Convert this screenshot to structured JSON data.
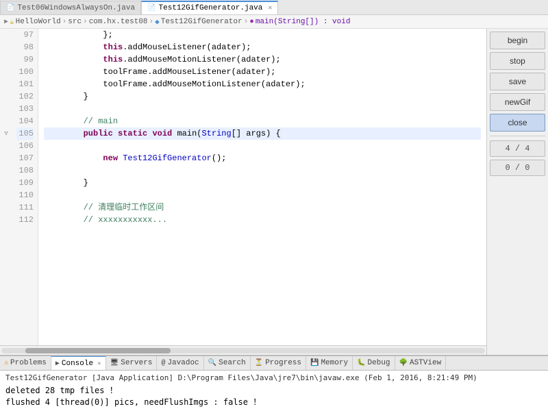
{
  "tabs": [
    {
      "label": "Test06WindowsAlwaysOn.java",
      "icon": "📄",
      "active": false
    },
    {
      "label": "Test12GifGenerator.java",
      "icon": "📄",
      "active": true,
      "closeable": true
    }
  ],
  "breadcrumb": {
    "items": [
      "HelloWorld",
      "src",
      "com.hx.test08",
      "Test12GifGenerator",
      "main(String[]) : void"
    ]
  },
  "code_lines": [
    {
      "num": 97,
      "text": "            };"
    },
    {
      "num": 98,
      "text": "            this.addMouseListener(adater);"
    },
    {
      "num": 99,
      "text": "            this.addMouseMotionListener(adater);"
    },
    {
      "num": 100,
      "text": "            toolFrame.addMouseListener(adater);"
    },
    {
      "num": 101,
      "text": "            toolFrame.addMouseMotionListener(adater);"
    },
    {
      "num": 102,
      "text": "        }"
    },
    {
      "num": 103,
      "text": ""
    },
    {
      "num": 104,
      "text": "        // main"
    },
    {
      "num": 105,
      "text": "        public static void main(String[] args) {",
      "collapse": true,
      "current": true
    },
    {
      "num": 106,
      "text": ""
    },
    {
      "num": 107,
      "text": "            new Test12GifGenerator();"
    },
    {
      "num": 108,
      "text": ""
    },
    {
      "num": 109,
      "text": "        }"
    },
    {
      "num": 110,
      "text": ""
    },
    {
      "num": 111,
      "text": "        // 清理临时工作区间"
    },
    {
      "num": 112,
      "text": "        // xxxxxxxxxxx..."
    }
  ],
  "right_panel": {
    "buttons": [
      {
        "label": "begin",
        "active": false
      },
      {
        "label": "stop",
        "active": false
      },
      {
        "label": "save",
        "active": false
      },
      {
        "label": "newGif",
        "active": false
      },
      {
        "label": "close",
        "active": true
      }
    ],
    "counts": [
      {
        "label": "4 / 4"
      },
      {
        "label": "0 / 0"
      }
    ]
  },
  "bottom_tabs": [
    {
      "label": "Problems",
      "icon": "⚠",
      "active": false
    },
    {
      "label": "Console",
      "icon": "▶",
      "active": true
    },
    {
      "label": "Servers",
      "icon": "🖥",
      "active": false
    },
    {
      "label": "Javadoc",
      "icon": "📖",
      "active": false
    },
    {
      "label": "Search",
      "icon": "🔍",
      "active": false
    },
    {
      "label": "Progress",
      "icon": "⏳",
      "active": false
    },
    {
      "label": "Memory",
      "icon": "💾",
      "active": false
    },
    {
      "label": "Debug",
      "icon": "🐛",
      "active": false
    },
    {
      "label": "ASTView",
      "icon": "🌳",
      "active": false
    }
  ],
  "console": {
    "header": "Test12GifGenerator [Java Application] D:\\Program Files\\Java\\jre7\\bin\\javaw.exe (Feb 1, 2016, 8:21:49 PM)",
    "lines": [
      "deleted 28 tmp files ！",
      "flushed 4 [thread(0)] pics, needFlushImgs : false ！"
    ]
  }
}
